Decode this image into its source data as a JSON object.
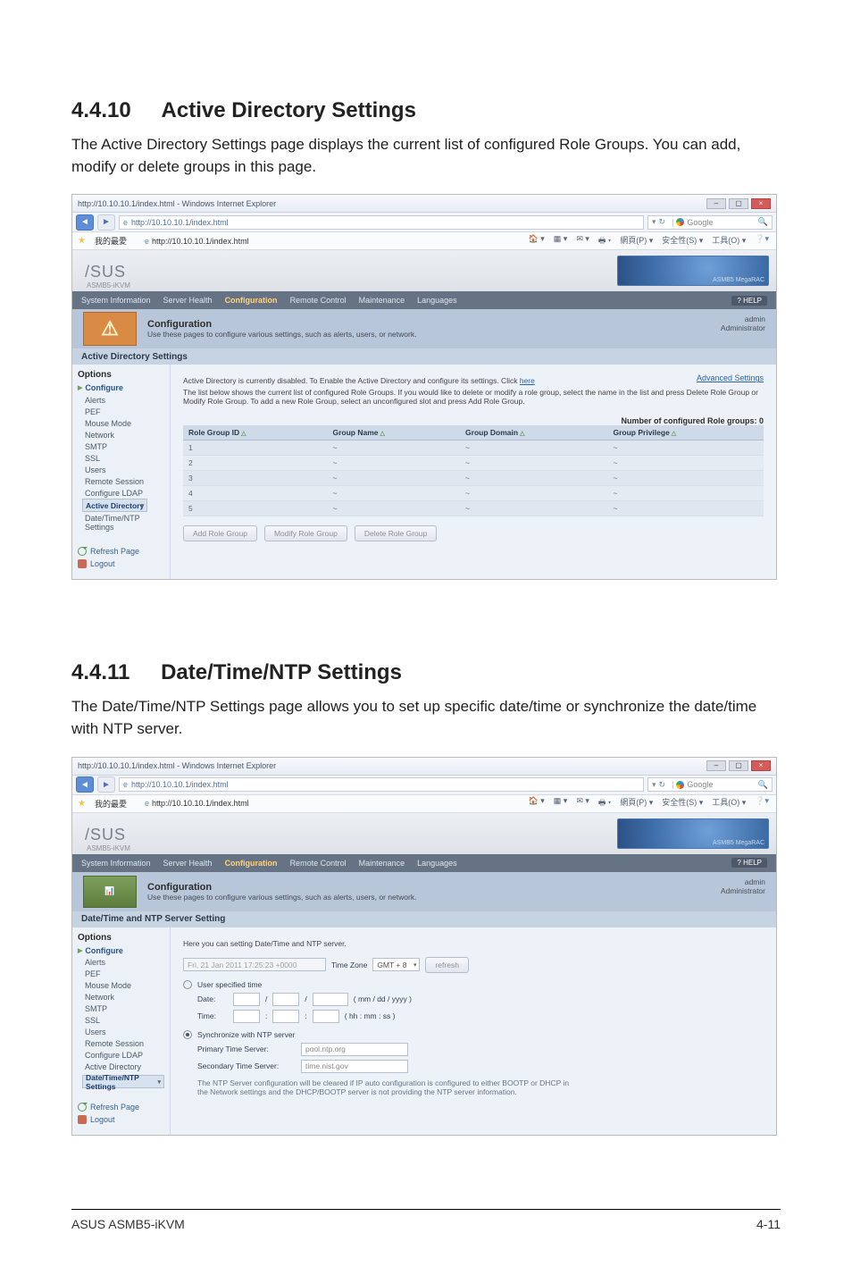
{
  "section1": {
    "number": "4.4.10",
    "title": "Active Directory Settings",
    "text": "The Active Directory Settings page displays the current list of configured Role Groups. You can add, modify or delete groups in this page."
  },
  "section2": {
    "number": "4.4.11",
    "title": "Date/Time/NTP Settings",
    "text": "The Date/Time/NTP Settings page allows you to set up specific date/time or synchronize the date/time with NTP server."
  },
  "footer": {
    "left": "ASUS ASMB5-iKVM",
    "right": "4-11"
  },
  "browser": {
    "title": "http://10.10.10.1/index.html - Windows Internet Explorer",
    "url_display": "http://10.10.10.1/index.html",
    "fav_tab": "我的最愛",
    "page_tab": "http://10.10.10.1/index.html",
    "search_placeholder": "Google",
    "toolbar_items": [
      "網頁(P) ▾",
      "安全性(S) ▾",
      "工具(O) ▾"
    ]
  },
  "app_common": {
    "brand": "/SUS",
    "brand_sub": "ASMB5-iKVM",
    "menu": {
      "items": [
        "System Information",
        "Server Health",
        "Configuration",
        "Remote Control",
        "Maintenance",
        "Languages"
      ],
      "active": "Configuration",
      "help": "? HELP"
    },
    "banner": {
      "title": "Configuration",
      "sub": "Use these pages to configure various settings, such as alerts, users, or network.",
      "user_name": "admin",
      "user_role": "Administrator"
    },
    "sidebar": {
      "title": "Options",
      "group": "Configure",
      "items": [
        "Alerts",
        "PEF",
        "Mouse Mode",
        "Network",
        "SMTP",
        "SSL",
        "Users",
        "Remote Session",
        "Configure LDAP",
        "Active Directory",
        "Date/Time/NTP Settings"
      ],
      "refresh": "Refresh Page",
      "logout": "Logout"
    }
  },
  "screenshot1": {
    "section_head": "Active Directory Settings",
    "advanced": "Advanced Settings",
    "sidebar_selected": "Active Directory",
    "line1_a": "Active Directory is currently disabled. To Enable the Active Directory and configure its settings. Click ",
    "line1_link": "here",
    "line2": "The list below shows the current list of configured Role Groups. If you would like to delete or modify a role group, select the name in the list and press Delete Role Group or Modify Role Group. To add a new Role Group, select an unconfigured slot and press Add Role Group.",
    "count_label": "Number of configured Role groups: 0",
    "table": {
      "headers": [
        "Role Group ID",
        "Group Name",
        "Group Domain",
        "Group Privilege"
      ],
      "rows": [
        {
          "id": "1",
          "name": "~",
          "domain": "~",
          "priv": "~"
        },
        {
          "id": "2",
          "name": "~",
          "domain": "~",
          "priv": "~"
        },
        {
          "id": "3",
          "name": "~",
          "domain": "~",
          "priv": "~"
        },
        {
          "id": "4",
          "name": "~",
          "domain": "~",
          "priv": "~"
        },
        {
          "id": "5",
          "name": "~",
          "domain": "~",
          "priv": "~"
        }
      ]
    },
    "buttons": {
      "add": "Add Role Group",
      "modify": "Modify Role Group",
      "delete": "Delete Role Group"
    }
  },
  "screenshot2": {
    "section_head": "Date/Time and NTP Server Setting",
    "sidebar_selected": "Date/Time/NTP Settings",
    "intro": "Here you can setting Date/Time and NTP server.",
    "datetime_value": "Fri, 21 Jan 2011 17:25:23 +0000",
    "tz_label": "Time Zone",
    "tz_value": "GMT + 8",
    "refresh_btn": "refresh",
    "radio_user": "User specified time",
    "date_lbl": "Date:",
    "date_hint": "( mm / dd / yyyy )",
    "time_lbl": "Time:",
    "time_hint": "( hh : mm : ss )",
    "radio_ntp": "Synchronize with NTP server",
    "primary_lbl": "Primary Time Server:",
    "primary_val": "pool.ntp.org",
    "secondary_lbl": "Secondary Time Server:",
    "secondary_val": "time.nist.gov",
    "note": "The NTP Server configuration will be cleared if IP auto configuration is configured to either BOOTP or DHCP in the Network settings and the DHCP/BOOTP server is not providing the NTP server information."
  }
}
